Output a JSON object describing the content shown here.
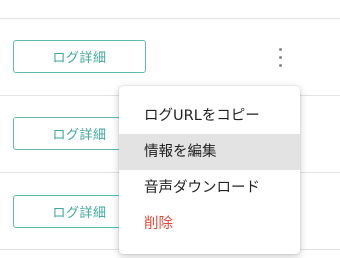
{
  "rows": [
    {
      "button_label": "ログ詳細"
    },
    {
      "button_label": "ログ詳細"
    },
    {
      "button_label": "ログ詳細"
    }
  ],
  "row_menu": {
    "icon": "more-vert-icon",
    "items": [
      {
        "label": "ログURLをコピー"
      },
      {
        "label": "情報を編集",
        "hovered": true
      },
      {
        "label": "音声ダウンロード"
      },
      {
        "label": "削除",
        "color": "#e04a3c"
      }
    ]
  },
  "colors": {
    "accent": "#3fa79d",
    "danger": "#e04a3c"
  }
}
